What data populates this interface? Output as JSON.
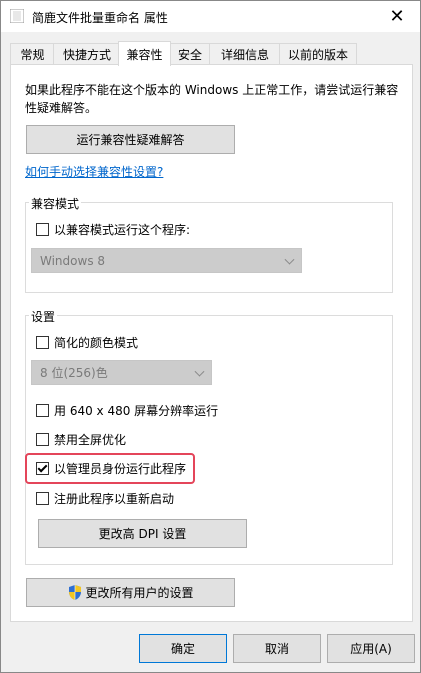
{
  "window": {
    "title": "简鹿文件批量重命名 属性"
  },
  "tabs": [
    {
      "label": "常规"
    },
    {
      "label": "快捷方式"
    },
    {
      "label": "兼容性"
    },
    {
      "label": "安全"
    },
    {
      "label": "详细信息"
    },
    {
      "label": "以前的版本"
    }
  ],
  "compat": {
    "intro": "如果此程序不能在这个版本的 Windows 上正常工作，请尝试运行兼容性疑难解答。",
    "troubleshoot_button": "运行兼容性疑难解答",
    "manual_link": "如何手动选择兼容性设置?",
    "mode_group": {
      "label": "兼容模式",
      "checkbox_label": "以兼容模式运行这个程序:",
      "checked": false,
      "select_value": "Windows 8"
    },
    "settings_group": {
      "label": "设置",
      "reduced_color": {
        "label": "简化的颜色模式",
        "checked": false
      },
      "color_select_value": "8 位(256)色",
      "res_640": {
        "label": "用 640 x 480 屏幕分辨率运行",
        "checked": false
      },
      "disable_fullscreen": {
        "label": "禁用全屏优化",
        "checked": false
      },
      "run_as_admin": {
        "label": "以管理员身份运行此程序",
        "checked": true
      },
      "register_restart": {
        "label": "注册此程序以重新启动",
        "checked": false
      },
      "dpi_button": "更改高 DPI 设置"
    },
    "all_users_button": "更改所有用户的设置"
  },
  "footer": {
    "ok": "确定",
    "cancel": "取消",
    "apply": "应用(A)"
  },
  "colors": {
    "accent": "#0078d7",
    "highlight": "#e4455a",
    "link": "#0066cc"
  }
}
